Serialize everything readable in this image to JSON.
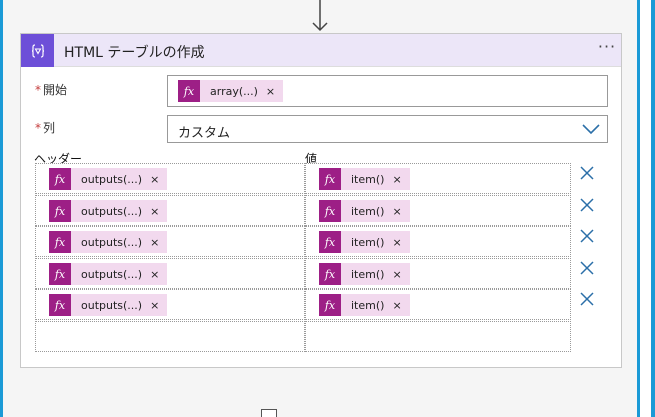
{
  "action": {
    "title": "HTML テーブルの作成",
    "more_label": "···",
    "icon": "table-action-icon"
  },
  "fields": {
    "start": {
      "required_mark": "*",
      "label": "開始",
      "token": {
        "fx": "fx",
        "label": "array(...)",
        "remove": "×"
      }
    },
    "columns": {
      "required_mark": "*",
      "label": "列",
      "value": "カスタム"
    }
  },
  "table": {
    "header_label": "ヘッダー",
    "value_label": "値",
    "rows": [
      {
        "header": {
          "fx": "fx",
          "label": "outputs(...)",
          "remove": "×"
        },
        "value": {
          "fx": "fx",
          "label": "item()",
          "remove": "×"
        }
      },
      {
        "header": {
          "fx": "fx",
          "label": "outputs(...)",
          "remove": "×"
        },
        "value": {
          "fx": "fx",
          "label": "item()",
          "remove": "×"
        }
      },
      {
        "header": {
          "fx": "fx",
          "label": "outputs(...)",
          "remove": "×"
        },
        "value": {
          "fx": "fx",
          "label": "item()",
          "remove": "×"
        }
      },
      {
        "header": {
          "fx": "fx",
          "label": "outputs(...)",
          "remove": "×"
        },
        "value": {
          "fx": "fx",
          "label": "item()",
          "remove": "×"
        }
      },
      {
        "header": {
          "fx": "fx",
          "label": "outputs(...)",
          "remove": "×"
        },
        "value": {
          "fx": "fx",
          "label": "item()",
          "remove": "×"
        }
      }
    ]
  },
  "colors": {
    "header_bg": "#ece6f8",
    "icon_bg": "#6d4fd8",
    "fx_bg": "#9d1f86",
    "token_bg": "#f2d9ee",
    "delete_icon": "#2b6fa8",
    "frame": "#1a9ad6"
  }
}
